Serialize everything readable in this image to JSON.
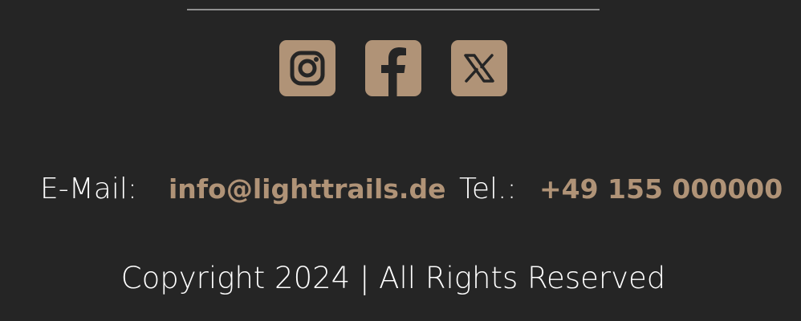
{
  "colors": {
    "background": "#252525",
    "accent": "#b09377",
    "text": "#ffffff",
    "divider": "#8f8f8f"
  },
  "social": [
    {
      "name": "instagram",
      "icon": "instagram-icon"
    },
    {
      "name": "facebook",
      "icon": "facebook-icon"
    },
    {
      "name": "x",
      "icon": "x-icon"
    }
  ],
  "contact": {
    "email_label": "E-Mail:",
    "email": "info@lighttrails.de",
    "tel_label": "Tel.:",
    "tel": "+49 155 000000"
  },
  "footer": {
    "copyright": "Copyright 2024 | All Rights Reserved"
  }
}
